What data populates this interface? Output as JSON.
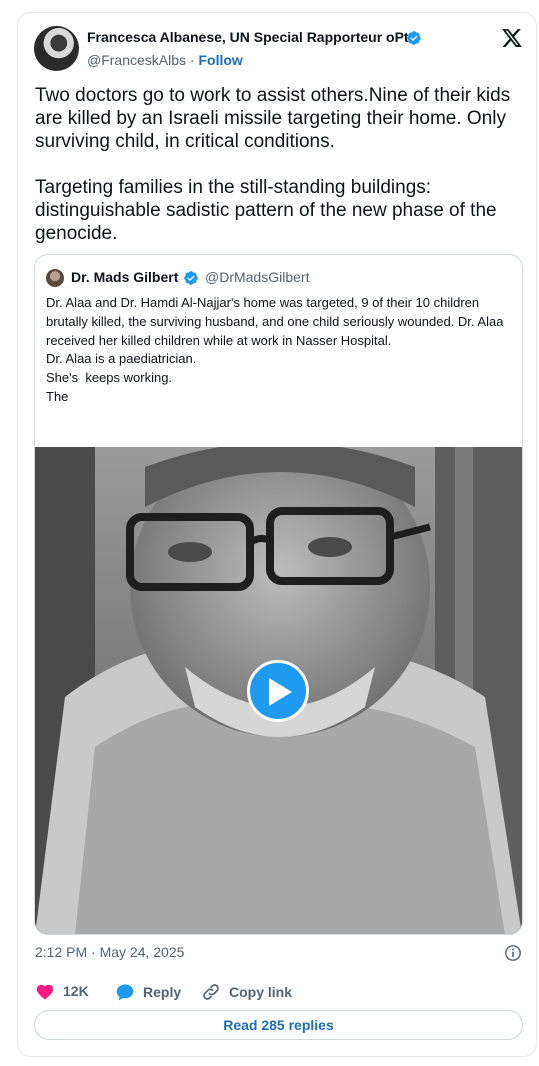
{
  "author": {
    "name": "Francesca Albanese, UN Special Rapporteur oPt",
    "handle": "@FranceskAlbs",
    "separator": " · ",
    "follow_label": "Follow",
    "verified": true
  },
  "tweet": {
    "paragraphs": [
      "Two doctors go to work to assist others.Nine of their kids are killed by an Israeli missile targeting their home. Only surviving child, in critical conditions.",
      "Targeting families in the still-standing buildings: distinguishable sadistic pattern of the new phase of the genocide."
    ]
  },
  "quote": {
    "name": "Dr. Mads Gilbert",
    "handle": "@DrMadsGilbert",
    "verified": true,
    "lines": [
      "Dr. Alaa and Dr. Hamdi Al-Najjar's home was targeted, 9 of their 10 children brutally killed, the surviving husband, and one child seriously wounded. Dr. Alaa received her killed children while at work in Nasser Hospital.",
      "Dr. Alaa is a paediatrician.",
      "She's  keeps working.",
      "The"
    ],
    "media": {
      "type": "video",
      "play_icon": "play-icon"
    }
  },
  "meta": {
    "timestamp": "2:12 PM · May 24, 2025"
  },
  "actions": {
    "like_count": "12K",
    "reply_label": "Reply",
    "copy_label": "Copy link"
  },
  "read_replies_label": "Read 285 replies",
  "colors": {
    "accent": "#1d9bf0",
    "link": "#1d6fb8",
    "like": "#f91880",
    "text": "#0f1419",
    "muted": "#536471"
  }
}
